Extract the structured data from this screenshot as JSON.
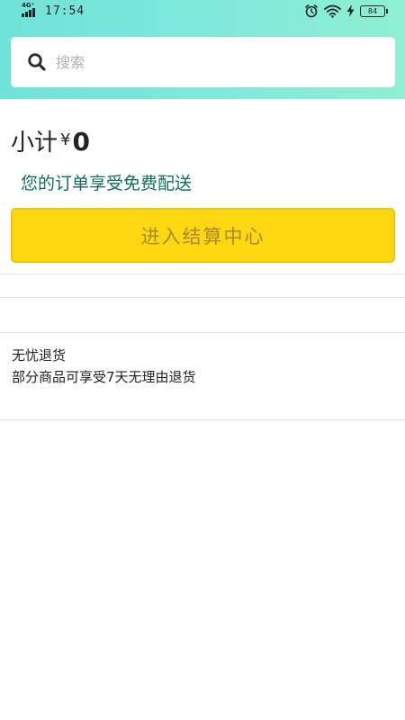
{
  "status_bar": {
    "network": "4G⁺",
    "time": "17:54",
    "battery_level": "84"
  },
  "search": {
    "placeholder": "搜索",
    "icon": "search-icon"
  },
  "cart": {
    "subtotal_label": "小计",
    "currency_symbol": "¥",
    "subtotal_value": "0",
    "free_shipping_text": "您的订单享受免费配送",
    "checkout_label": "进入结算中心"
  },
  "guarantee": {
    "title": "无忧退货",
    "description": "部分商品可享受7天无理由退货"
  },
  "colors": {
    "header_gradient_start": "#6fe3d9",
    "header_gradient_end": "#8ef0d2",
    "checkout_button": "#fdd711",
    "free_shipping_text": "#0f6e5c"
  }
}
